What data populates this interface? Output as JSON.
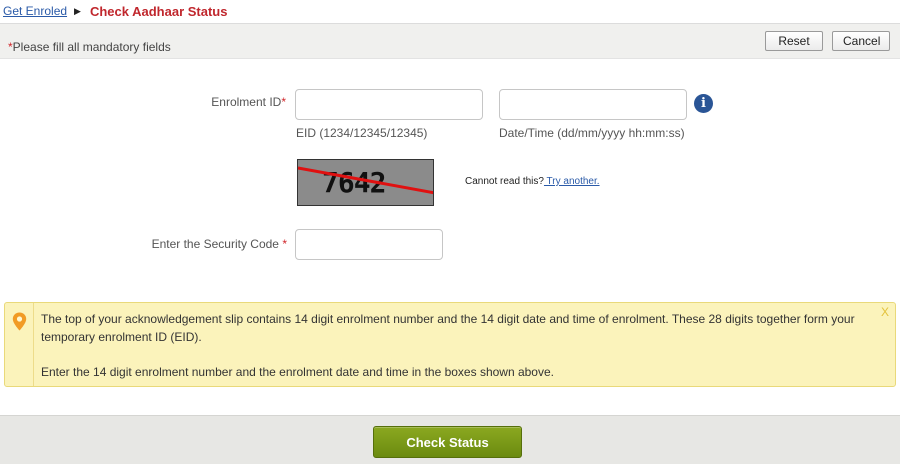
{
  "breadcrumb": {
    "parent": "Get Enroled",
    "separator": "▶",
    "current": "Check Aadhaar Status"
  },
  "toolbar": {
    "mandatory_star": "*",
    "mandatory_text": "Please fill all mandatory fields",
    "reset_label": "Reset",
    "cancel_label": "Cancel"
  },
  "form": {
    "enrolment_label": "Enrolment ID",
    "enrolment_star": "*",
    "eid_value": "",
    "eid_hint": "EID (1234/12345/12345)",
    "datetime_value": "",
    "datetime_hint": "Date/Time (dd/mm/yyyy hh:mm:ss)",
    "info_icon": "info-icon",
    "captcha_text": "7642",
    "cannot_read": "Cannot read this?",
    "try_another": " Try another.",
    "security_label": "Enter the Security Code",
    "security_star": "*",
    "security_value": ""
  },
  "notice": {
    "para1": "The top of your acknowledgement slip contains 14 digit enrolment number and the 14 digit date and time of enrolment. These 28 digits together form your temporary enrolment ID (EID).",
    "para2": "Enter the 14 digit enrolment number and the enrolment date and time in the boxes shown above.",
    "close": "X",
    "icon": "pin-icon"
  },
  "footer": {
    "check_status_label": "Check Status"
  },
  "colors": {
    "accent_red": "#c0272d",
    "link_blue": "#2a5aa8",
    "notice_bg": "#fbf3bb",
    "button_green": "#7a9a18"
  }
}
